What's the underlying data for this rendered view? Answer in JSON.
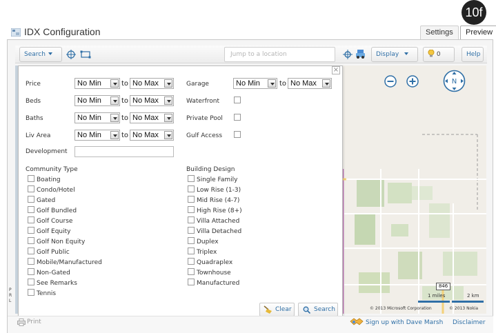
{
  "badge": "10f",
  "header": {
    "title": "IDX Configuration",
    "tabs": [
      "Settings",
      "Preview"
    ]
  },
  "toolbar": {
    "search_label": "Search",
    "jump_placeholder": "Jump to a location",
    "display_label": "Display",
    "count": "0",
    "help_label": "Help"
  },
  "form": {
    "price": {
      "label": "Price",
      "min": "No Min",
      "max": "No Max"
    },
    "beds": {
      "label": "Beds",
      "min": "No Min",
      "max": "No Max"
    },
    "baths": {
      "label": "Baths",
      "min": "No Min",
      "max": "No Max"
    },
    "liv_area": {
      "label": "Liv Area",
      "min": "No Min",
      "max": "No Max"
    },
    "garage": {
      "label": "Garage",
      "min": "No Min",
      "max": "No Max"
    },
    "to_text": "to",
    "waterfront": "Waterfront",
    "private_pool": "Private Pool",
    "gulf_access": "Gulf Access",
    "development": "Development",
    "community_type": {
      "title": "Community Type",
      "items": [
        "Boating",
        "Condo/Hotel",
        "Gated",
        "Golf Bundled",
        "Golf Course",
        "Golf Equity",
        "Golf Non Equity",
        "Golf Public",
        "Mobile/Manufactured",
        "Non-Gated",
        "See Remarks",
        "Tennis"
      ]
    },
    "building_design": {
      "title": "Building Design",
      "items": [
        "Single Family",
        "Low Rise (1-3)",
        "Mid Rise (4-7)",
        "High Rise (8+)",
        "Villa Attached",
        "Villa Detached",
        "Duplex",
        "Triplex",
        "Quadraplex",
        "Townhouse",
        "Manufactured"
      ]
    },
    "clear_label": "Clear",
    "search_label": "Search"
  },
  "map": {
    "compass": "N",
    "road_shield": "846",
    "scale_miles": "1 miles",
    "scale_km": "2 km",
    "copyright_ms": "© 2013 Microsoft Corporation",
    "copyright_nokia": "© 2013 Nokia",
    "side_letters": [
      "P",
      "R",
      "L"
    ]
  },
  "footer": {
    "print": "Print",
    "signup": "Sign up with Dave Marsh",
    "disclaimer": "Disclaimer"
  },
  "colors": {
    "link": "#2f6fa6",
    "map_bg": "#f1eee8",
    "water_strip": "#7397c5",
    "road": "#b35aa3"
  }
}
